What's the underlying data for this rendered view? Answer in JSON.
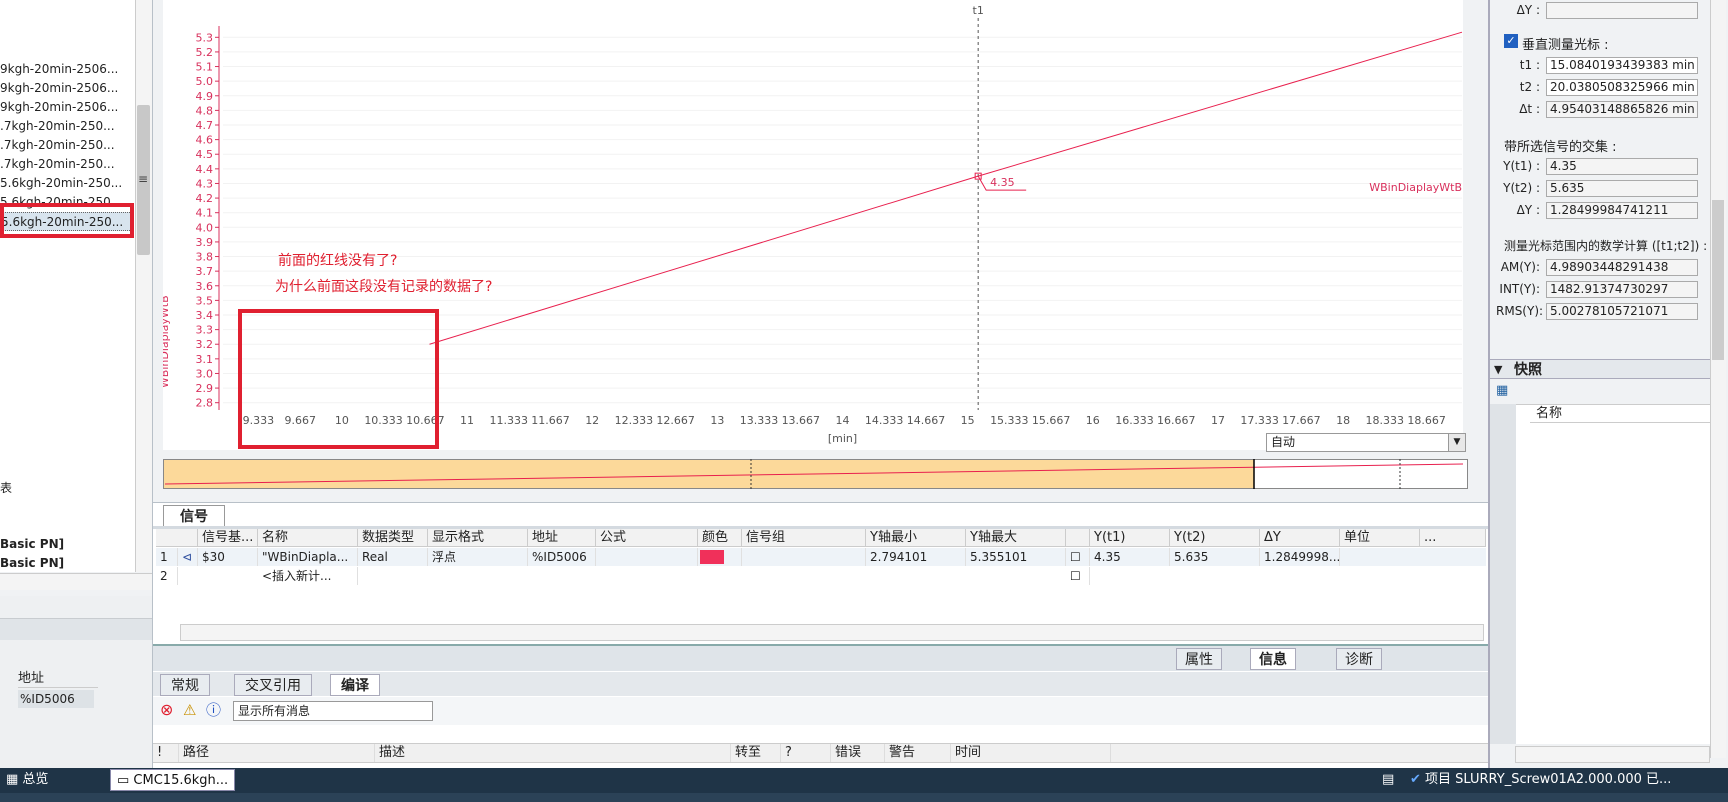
{
  "tree": {
    "items": [
      {
        "label": "9kgh-20min-2506..."
      },
      {
        "label": "9kgh-20min-2506..."
      },
      {
        "label": "9kgh-20min-2506..."
      },
      {
        "label": ".7kgh-20min-250..."
      },
      {
        "label": ".7kgh-20min-250..."
      },
      {
        "label": ".7kgh-20min-250..."
      },
      {
        "label": "5.6kgh-20min-250..."
      },
      {
        "label": "5.6kgh-20min-250..."
      },
      {
        "label": "5.6kgh-20min-250..."
      }
    ],
    "lower_label": "表",
    "pn1": "Basic PN]",
    "pn2": "Basic PN]",
    "addr_header": "地址",
    "addr_value": "%ID5006"
  },
  "chart_data": {
    "type": "line",
    "title": "",
    "cursor_label": "t1",
    "ylabel": "WBinDiaplayWtB",
    "xlabel": "[min]",
    "series_label": "WBinDiaplayWtB",
    "yticks": [
      "5.3",
      "5.2",
      "5.1",
      "5.0",
      "4.9",
      "4.8",
      "4.7",
      "4.6",
      "4.5",
      "4.4",
      "4.3",
      "4.2",
      "4.1",
      "4.0",
      "3.9",
      "3.8",
      "3.7",
      "3.6",
      "3.5",
      "3.4",
      "3.3",
      "3.2",
      "3.1",
      "3.0",
      "2.9",
      "2.8"
    ],
    "xticks": [
      "9.333",
      "9.667",
      "10",
      "10.333",
      "10.667",
      "11",
      "11.333",
      "11.667",
      "12",
      "12.333",
      "12.667",
      "13",
      "13.333",
      "13.667",
      "14",
      "14.333",
      "14.667",
      "15",
      "15.333",
      "15.667",
      "16",
      "16.333",
      "16.667",
      "17",
      "17.333",
      "17.667",
      "18",
      "18.333",
      "18.667"
    ],
    "ylim": [
      2.75,
      5.35
    ],
    "xlim": [
      9.05,
      18.95
    ],
    "series": [
      {
        "name": "WBinDiaplayWtB",
        "x": [
          10.7,
          15.084,
          18.95
        ],
        "y": [
          3.2,
          4.35,
          5.335
        ]
      }
    ],
    "cursor_x": 15.084,
    "cursor_value": "4.35",
    "zoom_mode": "自动",
    "colors": {
      "series": "#e8204e",
      "axis": "#d8305c"
    }
  },
  "annotations": {
    "line1": "前面的红线没有了?",
    "line2": "为什么前面这段没有记录的数据了?"
  },
  "signal_table": {
    "tab": "信号",
    "headers": [
      "信号基...",
      "名称",
      "数据类型",
      "显示格式",
      "地址",
      "公式",
      "颜色",
      "信号组",
      "Y轴最小",
      "Y轴最大",
      "Y(t1)",
      "Y(t2)",
      "ΔY",
      "单位",
      "..."
    ],
    "rows": [
      {
        "num": "1",
        "base": "$30",
        "name": "\"WBinDiapla...",
        "type": "Real",
        "format": "浮点",
        "addr": "%ID5006",
        "ymin": "2.794101",
        "ymax": "5.355101",
        "yt1": "4.35",
        "yt2": "5.635",
        "dy": "1.2849998..."
      },
      {
        "num": "2",
        "name": "<插入新计..."
      }
    ],
    "color_swatch": "#f0305a"
  },
  "inspector": {
    "tabs": [
      "属性",
      "信息",
      "诊断"
    ],
    "subtabs": [
      "常规",
      "交叉引用",
      "编译"
    ],
    "filter": "显示所有消息",
    "msg_headers": [
      "!",
      "路径",
      "描述",
      "转至",
      "?",
      "错误",
      "警告",
      "时间"
    ]
  },
  "right_panel": {
    "dy_label": "ΔY :",
    "vcursor_label": "垂直测量光标 :",
    "t1_label": "t1 :",
    "t1": "15.0840193439383 min",
    "t2_label": "t2 :",
    "t2": "20.0380508325966 min",
    "dt_label": "Δt :",
    "dt": "4.95403148865826 min",
    "intersect_label": "带所选信号的交集 :",
    "yt1_label": "Y(t1) :",
    "yt1": "4.35",
    "yt2_label": "Y(t2) :",
    "yt2": "5.635",
    "dy2_label": "ΔY :",
    "dy2": "1.28499984741211",
    "calc_label": "测量光标范围内的数学计算 ([t1;t2]) :",
    "am_label": "AM(Y):",
    "am": "4.98903448291438",
    "int_label": "INT(Y):",
    "int": "1482.91374730297",
    "rms_label": "RMS(Y):",
    "rms": "5.00278105721071",
    "snapshot": "快照",
    "name_col": "名称"
  },
  "taskbar": {
    "overview": "总览",
    "window": "CMC15.6kgh...",
    "project": "项目 SLURRY_Screw01A2.000.000 已..."
  }
}
